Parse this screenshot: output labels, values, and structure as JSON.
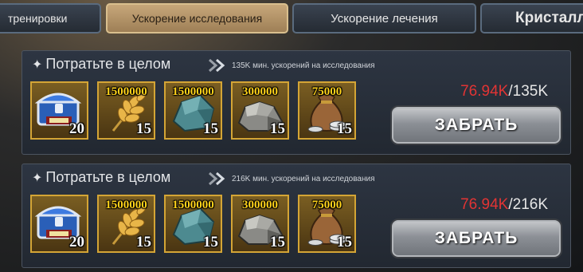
{
  "tabs": [
    {
      "label": "тренировки"
    },
    {
      "label": "Ускорение исследования",
      "active": true
    },
    {
      "label": "Ускорение лечения"
    },
    {
      "label": "Кристалл"
    }
  ],
  "panels": [
    {
      "title": "Потратьте в целом",
      "description": "135K мин. ускорений на исследования",
      "progress_current": "76.94K",
      "progress_total": "/135K",
      "claim_label": "ЗАБРАТЬ",
      "rewards": [
        {
          "icon": "chest-icon",
          "amount": "",
          "count": "20"
        },
        {
          "icon": "wheat-icon",
          "amount": "1500000",
          "count": "15"
        },
        {
          "icon": "stone-icon",
          "amount": "1500000",
          "count": "15"
        },
        {
          "icon": "ore-icon",
          "amount": "300000",
          "count": "15"
        },
        {
          "icon": "silver-bag-icon",
          "amount": "75000",
          "count": "15"
        }
      ]
    },
    {
      "title": "Потратьте в целом",
      "description": "216K мин. ускорений на исследования",
      "progress_current": "76.94K",
      "progress_total": "/216K",
      "claim_label": "ЗАБРАТЬ",
      "rewards": [
        {
          "icon": "chest-icon",
          "amount": "",
          "count": "20"
        },
        {
          "icon": "wheat-icon",
          "amount": "1500000",
          "count": "15"
        },
        {
          "icon": "stone-icon",
          "amount": "1500000",
          "count": "15"
        },
        {
          "icon": "ore-icon",
          "amount": "300000",
          "count": "15"
        },
        {
          "icon": "silver-bag-icon",
          "amount": "75000",
          "count": "15"
        }
      ]
    }
  ],
  "colors": {
    "progress_current": "#e23434",
    "active_tab": "#c7a77a",
    "item_border": "#d4a535",
    "item_amount": "#ffd21a"
  }
}
